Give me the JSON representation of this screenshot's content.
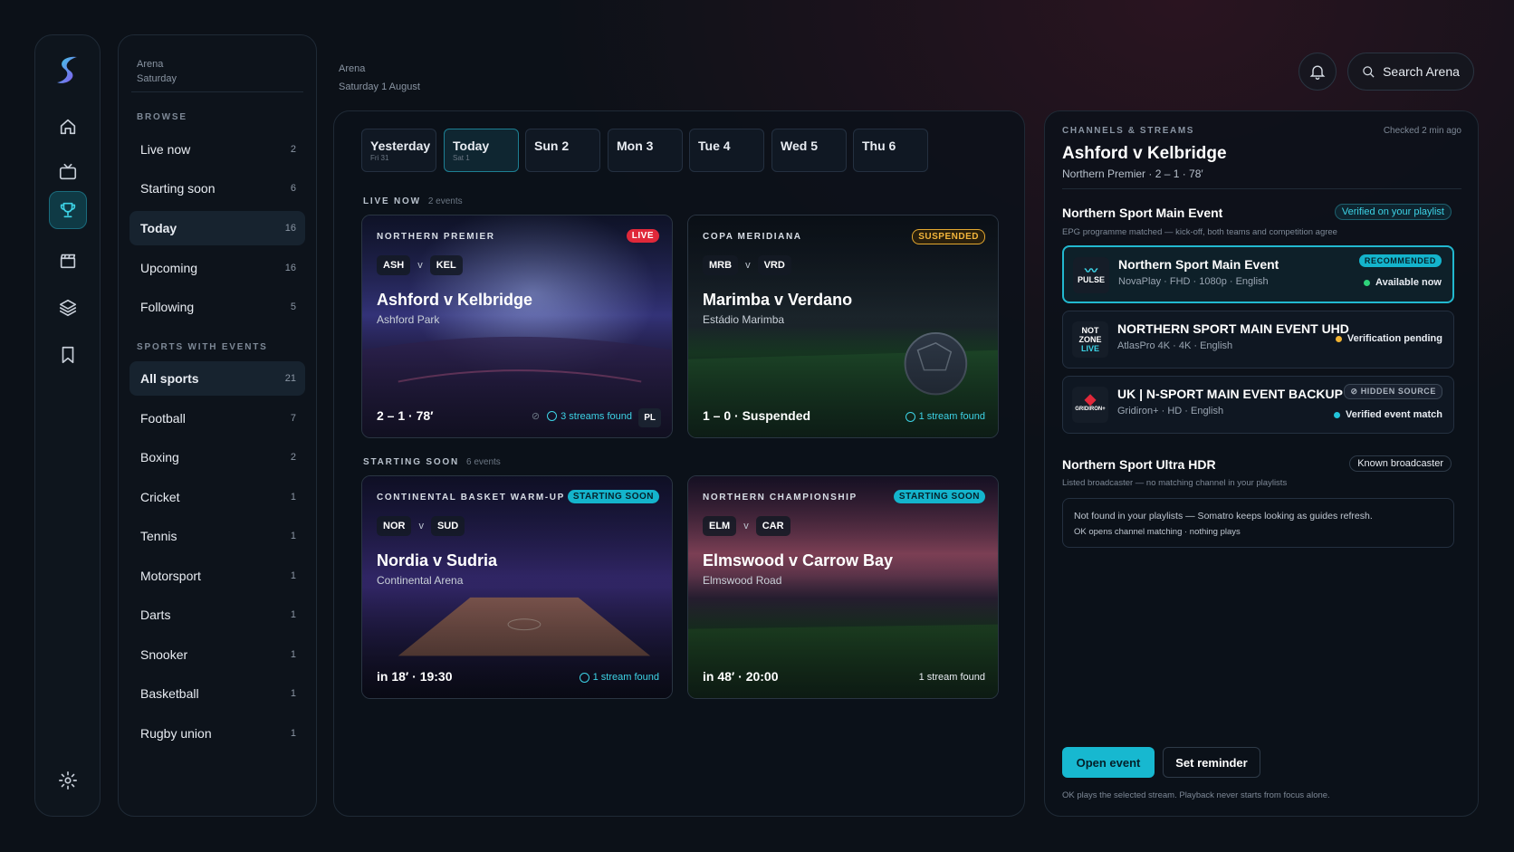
{
  "nav": {
    "active": "trophy-icon"
  },
  "sidebar": {
    "app": "Arena",
    "day": "Saturday",
    "browse_heading": "BROWSE",
    "sports_heading": "SPORTS WITH EVENTS",
    "browse": [
      {
        "label": "Live now",
        "count": "2"
      },
      {
        "label": "Starting soon",
        "count": "6"
      },
      {
        "label": "Today",
        "count": "16"
      },
      {
        "label": "Upcoming",
        "count": "16"
      },
      {
        "label": "Following",
        "count": "5"
      }
    ],
    "sports": [
      {
        "label": "All sports",
        "count": "21"
      },
      {
        "label": "Football",
        "count": "7"
      },
      {
        "label": "Boxing",
        "count": "2"
      },
      {
        "label": "Cricket",
        "count": "1"
      },
      {
        "label": "Tennis",
        "count": "1"
      },
      {
        "label": "Motorsport",
        "count": "1"
      },
      {
        "label": "Darts",
        "count": "1"
      },
      {
        "label": "Snooker",
        "count": "1"
      },
      {
        "label": "Basketball",
        "count": "1"
      },
      {
        "label": "Rugby union",
        "count": "1"
      }
    ]
  },
  "header": {
    "app": "Arena",
    "date": "Saturday 1 August",
    "search_label": "Search Arena"
  },
  "days": [
    {
      "label": "Yesterday",
      "sub": "Fri 31"
    },
    {
      "label": "Today",
      "sub": "Sat 1"
    },
    {
      "label": "Sun 2",
      "sub": ""
    },
    {
      "label": "Mon 3",
      "sub": ""
    },
    {
      "label": "Tue 4",
      "sub": ""
    },
    {
      "label": "Wed 5",
      "sub": ""
    },
    {
      "label": "Thu 6",
      "sub": ""
    }
  ],
  "live": {
    "heading": "LIVE NOW",
    "count": "2 events"
  },
  "soon": {
    "heading": "STARTING SOON",
    "count": "6 events"
  },
  "events": [
    {
      "comp": "NORTHERN PREMIER",
      "badge": "LIVE",
      "home": "ASH",
      "away": "KEL",
      "v": "v",
      "title": "Ashford v Kelbridge",
      "venue": "Ashford Park",
      "status": "2 – 1 · 78′",
      "streams": "3 streams found",
      "channel": "PL"
    },
    {
      "comp": "COPA MERIDIANA",
      "badge": "SUSPENDED",
      "home": "MRB",
      "away": "VRD",
      "v": "v",
      "title": "Marimba v Verdano",
      "venue": "Estádio Marimba",
      "status": "1 – 0 · Suspended",
      "streams": "1 stream found"
    },
    {
      "comp": "CONTINENTAL BASKET WARM-UP",
      "badge": "STARTING SOON",
      "home": "NOR",
      "away": "SUD",
      "v": "v",
      "title": "Nordia v Sudria",
      "venue": "Continental Arena",
      "status": "in 18′ · 19:30",
      "streams": "1 stream found"
    },
    {
      "comp": "NORTHERN CHAMPIONSHIP",
      "badge": "STARTING SOON",
      "home": "ELM",
      "away": "CAR",
      "v": "v",
      "title": "Elmswood v Carrow Bay",
      "venue": "Elmswood Road",
      "status": "in 48′ · 20:00",
      "streams": "1 stream found"
    }
  ],
  "panel": {
    "kicker": "CHANNELS & STREAMS",
    "checked": "Checked 2 min ago",
    "title": "Ashford v Kelbridge",
    "subtitle": "Northern Premier · 2 – 1 · 78′",
    "ch1": {
      "name": "Northern Sport Main Event",
      "badge": "Verified on your playlist",
      "note": "EPG programme matched — kick-off, both teams and competition agree"
    },
    "streams": [
      {
        "logo1": "PULSE",
        "logo2": "",
        "logo3": "",
        "name": "Northern Sport Main Event",
        "sub": "NovaPlay · FHD · 1080p · English",
        "tag": "RECOMMENDED",
        "status": "Available now",
        "dot": "#2fd37a"
      },
      {
        "logo1": "NOT",
        "logo2": "ZONE",
        "logo3": "LIVE",
        "name": "NORTHERN SPORT MAIN EVENT UHD",
        "sub": "AtlasPro 4K · 4K · English",
        "tag": "",
        "status": "Verification pending",
        "dot": "#f0b232"
      },
      {
        "logo1": "GRIDIRON+",
        "logo2": "",
        "logo3": "",
        "name": "UK | N-SPORT MAIN EVENT BACKUP",
        "sub": "Gridiron+ · HD · English",
        "tag": "HIDDEN SOURCE",
        "status": "Verified event match",
        "dot": "#22c3da"
      }
    ],
    "ch2": {
      "name": "Northern Sport Ultra HDR",
      "badge": "Known broadcaster",
      "note": "Listed broadcaster — no matching channel in your playlists"
    },
    "notfound1": "Not found in your playlists — Somatro keeps looking as guides refresh.",
    "notfound2": "OK opens channel matching · nothing plays",
    "open": "Open event",
    "remind": "Set reminder",
    "footer": "OK plays the selected stream. Playback never starts from focus alone."
  },
  "colors": {
    "accent": "#17b8d0",
    "live": "#e0283a",
    "suspended": "#e3a72f"
  }
}
